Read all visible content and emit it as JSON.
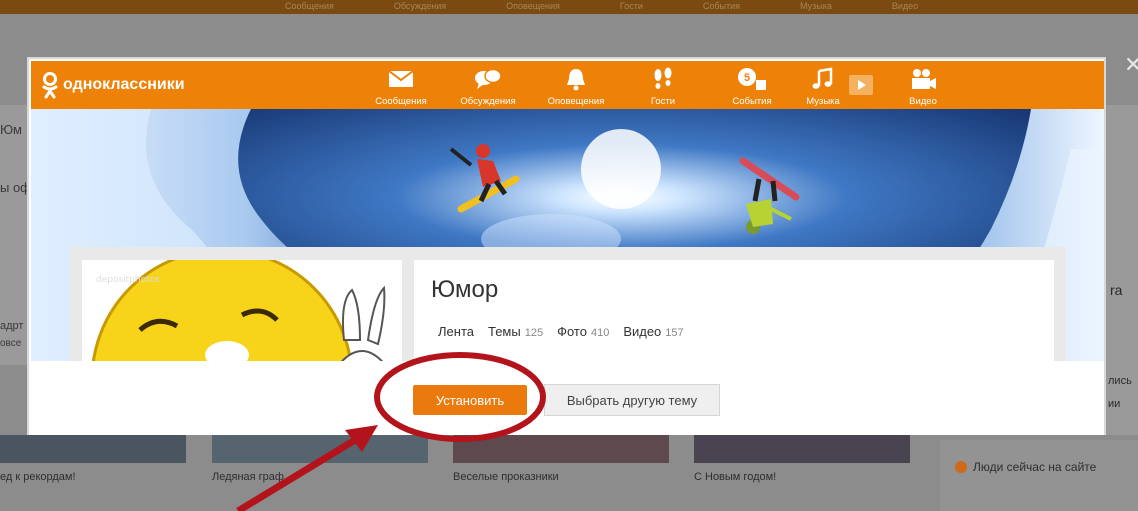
{
  "background": {
    "top_nav": [
      "Сообщения",
      "Обсуждения",
      "Оповещения",
      "Гости",
      "События",
      "Музыка",
      "Видео"
    ],
    "left_fragments": [
      "Юм",
      "ы оф",
      "адрт",
      "овсе"
    ],
    "right_fragments": [
      "ra",
      "лись",
      "ии"
    ],
    "captions": [
      "ед к рекордам!",
      "Ледяная граф...",
      "Веселые проказники",
      "С Новым годом!"
    ],
    "people_online": "Люди сейчас на сайте"
  },
  "header": {
    "logo_text": "одноклассники",
    "nav": [
      {
        "label": "Сообщения",
        "icon": "envelope-icon"
      },
      {
        "label": "Обсуждения",
        "icon": "chat-bubbles-icon"
      },
      {
        "label": "Оповещения",
        "icon": "bell-icon"
      },
      {
        "label": "Гости",
        "icon": "footprints-icon"
      },
      {
        "label": "События",
        "icon": "events-icon",
        "badge": "5"
      },
      {
        "label": "Музыка",
        "icon": "music-note-icon"
      },
      {
        "label": "Видео",
        "icon": "video-camera-icon"
      }
    ]
  },
  "group": {
    "title": "Юмор",
    "tabs": [
      {
        "label": "Лента",
        "count": ""
      },
      {
        "label": "Темы",
        "count": "125"
      },
      {
        "label": "Фото",
        "count": "410"
      },
      {
        "label": "Видео",
        "count": "157"
      }
    ],
    "watermark": "depositphotos"
  },
  "actions": {
    "install_label": "Установить",
    "other_theme_label": "Выбрать другую тему"
  },
  "colors": {
    "brand_orange": "#ee8208",
    "button_orange": "#eb7a0e",
    "annotation_red": "#b3141c"
  }
}
